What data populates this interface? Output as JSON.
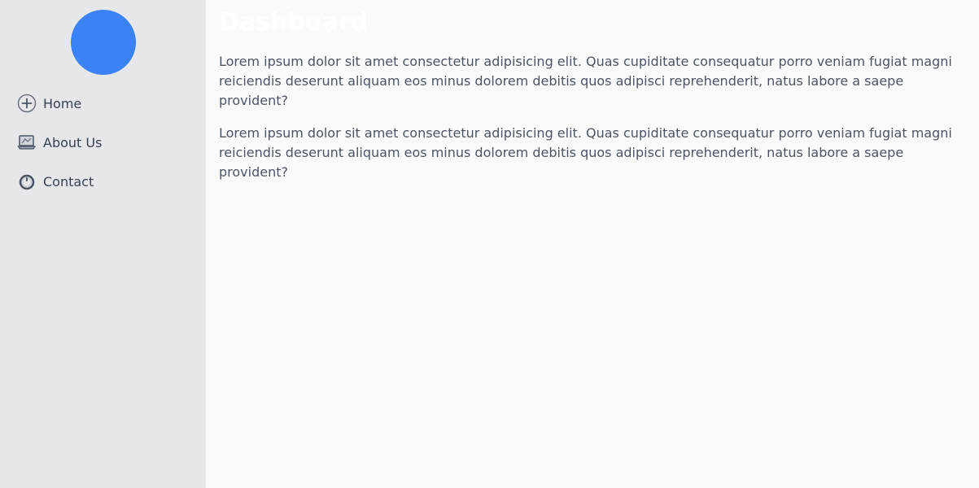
{
  "colors": {
    "accent": "#3b82f6",
    "sidebar_bg": "#e5e7eb",
    "main_bg": "#f9fafb",
    "text": "#374151",
    "muted_text": "#4b5563",
    "title_text": "#ffffff"
  },
  "sidebar": {
    "avatar_icon": "avatar-circle",
    "items": [
      {
        "label": "Home",
        "icon": "plus-circle-icon"
      },
      {
        "label": "About Us",
        "icon": "laptop-icon"
      },
      {
        "label": "Contact",
        "icon": "power-icon"
      }
    ]
  },
  "main": {
    "title": "Dashboard",
    "paragraphs": [
      "Lorem ipsum dolor sit amet consectetur adipisicing elit. Quas cupiditate consequatur porro veniam fugiat magni reiciendis deserunt aliquam eos minus dolorem debitis quos adipisci reprehenderit, natus labore a saepe provident?",
      "Lorem ipsum dolor sit amet consectetur adipisicing elit. Quas cupiditate consequatur porro veniam fugiat magni reiciendis deserunt aliquam eos minus dolorem debitis quos adipisci reprehenderit, natus labore a saepe provident?"
    ]
  }
}
